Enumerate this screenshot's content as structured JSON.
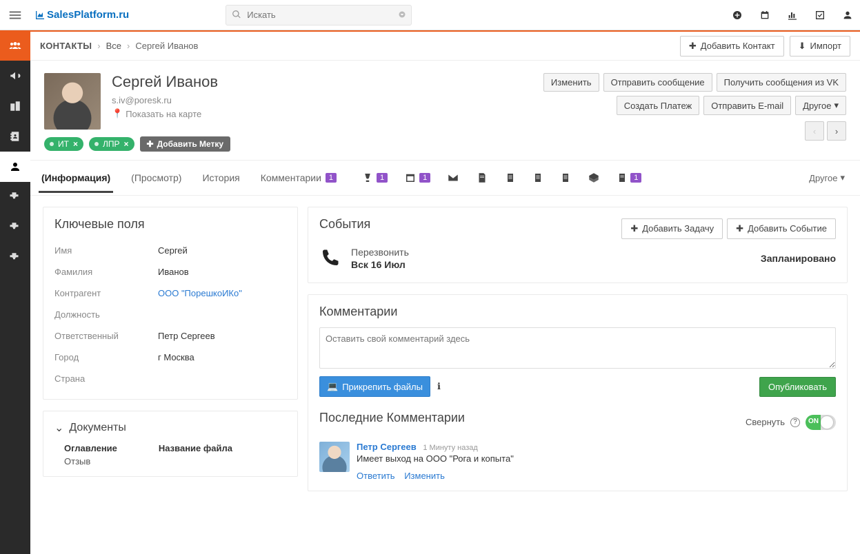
{
  "logo_text": "SalesPlatform.ru",
  "search": {
    "placeholder": "Искать"
  },
  "breadcrumb": {
    "module": "КОНТАКТЫ",
    "all": "Все",
    "current": "Сергей Иванов"
  },
  "top_actions": {
    "add": "Добавить Контакт",
    "import": "Импорт"
  },
  "person": {
    "name": "Сергей Иванов",
    "email": "s.iv@poresk.ru",
    "map": "Показать на карте"
  },
  "head_actions": {
    "edit": "Изменить",
    "sendmsg": "Отправить сообщение",
    "vk": "Получить сообщения из VK",
    "payment": "Создать Платеж",
    "email": "Отправить E-mail",
    "other": "Другое"
  },
  "tags": {
    "t1": "ИТ",
    "t2": "ЛПР",
    "add": "Добавить Метку"
  },
  "tabs": {
    "info": "(Информация)",
    "view": "(Просмотр)",
    "history": "История",
    "comments": "Комментарии",
    "comments_badge": "1",
    "money_badge": "1",
    "cal_badge": "1",
    "doc_badge": "1",
    "other": "Другое"
  },
  "keyfields": {
    "title": "Ключевые поля",
    "first_name_l": "Имя",
    "first_name_v": "Сергей",
    "last_name_l": "Фамилия",
    "last_name_v": "Иванов",
    "account_l": "Контрагент",
    "account_v": "ООО \"ПорешкоИКо\"",
    "position_l": "Должность",
    "position_v": "",
    "owner_l": "Ответственный",
    "owner_v": "Петр Сергеев",
    "city_l": "Город",
    "city_v": "г Москва",
    "country_l": "Страна",
    "country_v": ""
  },
  "documents": {
    "title": "Документы",
    "col1": "Оглавление",
    "col2": "Название файла",
    "row1": "Отзыв"
  },
  "events": {
    "title": "События",
    "add_task": "Добавить Задачу",
    "add_event": "Добавить Событие",
    "call_title": "Перезвонить",
    "call_date": "Вск 16 Июл",
    "status": "Запланировано"
  },
  "comments": {
    "title": "Комментарии",
    "placeholder": "Оставить свой комментарий здесь",
    "attach": "Прикрепить файлы",
    "publish": "Опубликовать"
  },
  "recent": {
    "title": "Последние Комментарии",
    "collapse": "Свернуть",
    "author": "Петр Сергеев",
    "time": "1 Минуту назад",
    "text": "Имеет выход на ООО \"Рога и копыта\"",
    "reply": "Ответить",
    "edit": "Изменить"
  }
}
